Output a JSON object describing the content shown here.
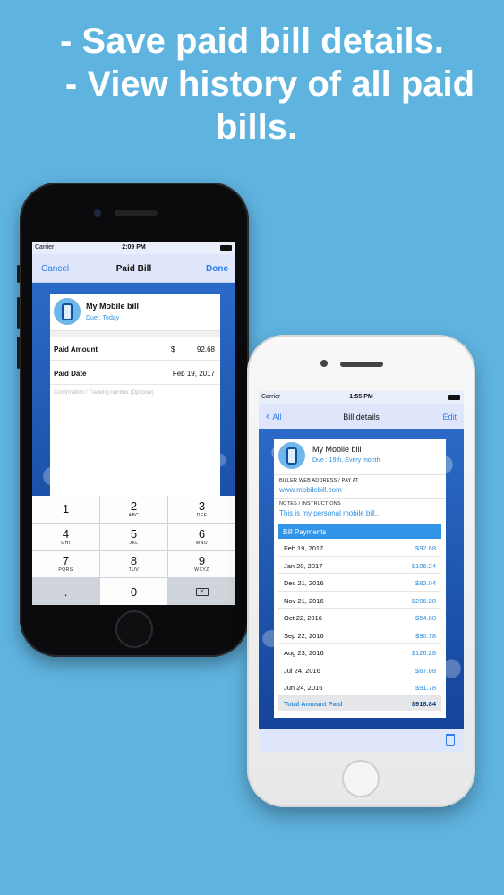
{
  "headline": {
    "line1": "- Save paid bill details.",
    "line2": "- View history of all paid",
    "line3": "bills."
  },
  "phone_a": {
    "status": {
      "carrier": "Carrier",
      "time": "2:09 PM"
    },
    "nav": {
      "left": "Cancel",
      "title": "Paid Bill",
      "right": "Done"
    },
    "bill": {
      "name": "My Mobile bill",
      "due": "Due : Today"
    },
    "paid_amount": {
      "label": "Paid Amount",
      "currency": "$",
      "value": "92.68"
    },
    "paid_date": {
      "label": "Paid Date",
      "value": "Feb 19, 2017"
    },
    "confirmation_placeholder": "Confirmation / Tracking number (Optional)",
    "keypad": [
      {
        "n": "1",
        "s": ""
      },
      {
        "n": "2",
        "s": "ABC"
      },
      {
        "n": "3",
        "s": "DEF"
      },
      {
        "n": "4",
        "s": "GHI"
      },
      {
        "n": "5",
        "s": "JKL"
      },
      {
        "n": "6",
        "s": "MNO"
      },
      {
        "n": "7",
        "s": "PQRS"
      },
      {
        "n": "8",
        "s": "TUV"
      },
      {
        "n": "9",
        "s": "WXYZ"
      },
      {
        "n": ".",
        "s": ""
      },
      {
        "n": "0",
        "s": ""
      }
    ],
    "backspace_icon": "backspace-icon"
  },
  "phone_b": {
    "status": {
      "carrier": "Carrier",
      "time": "1:55 PM"
    },
    "nav": {
      "left": "All",
      "title": "Bill details",
      "right": "Edit"
    },
    "bill": {
      "name": "My Mobile bill",
      "due": "Due : 19th, Every month"
    },
    "biller_label": "BILLER WEB ADDRESS / PAY AT",
    "biller_value": "www.mobilebill.com",
    "notes_label": "NOTES / INSTRUCTIONS",
    "notes_value": "This is my personal mobile bill..",
    "payments_header": "Bill Payments",
    "payments": [
      {
        "date": "Feb 19, 2017",
        "amount": "$92.68"
      },
      {
        "date": "Jan 20, 2017",
        "amount": "$106.24"
      },
      {
        "date": "Dec 21, 2016",
        "amount": "$82.04"
      },
      {
        "date": "Nov 21, 2016",
        "amount": "$206.28"
      },
      {
        "date": "Oct 22, 2016",
        "amount": "$54.88"
      },
      {
        "date": "Sep 22, 2016",
        "amount": "$90.78"
      },
      {
        "date": "Aug 23, 2016",
        "amount": "$126.28"
      },
      {
        "date": "Jul 24, 2016",
        "amount": "$67.88"
      },
      {
        "date": "Jun 24, 2016",
        "amount": "$91.78"
      }
    ],
    "total": {
      "label": "Total Amount Paid",
      "value": "$918.84"
    }
  },
  "colors": {
    "background": "#5fb3df",
    "accent": "#2f7ee8",
    "payments_header": "#3194e8"
  }
}
